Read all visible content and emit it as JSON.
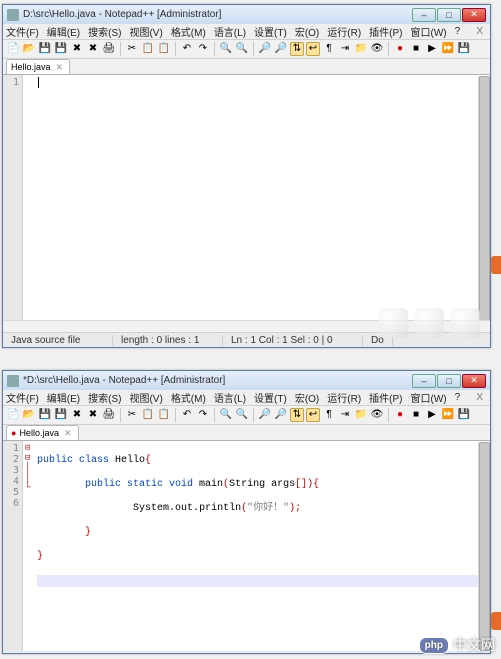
{
  "window1": {
    "title": "D:\\src\\Hello.java - Notepad++ [Administrator]",
    "tab_label": "Hello.java",
    "line_numbers": [
      "1"
    ],
    "code_lines": [
      ""
    ],
    "statusbar": {
      "type": "Java source file",
      "length": "length : 0    lines : 1",
      "pos": "Ln : 1    Col : 1    Sel : 0 | 0",
      "enc": "Do"
    }
  },
  "window2": {
    "title": "*D:\\src\\Hello.java - Notepad++ [Administrator]",
    "tab_label": "Hello.java",
    "line_numbers": [
      "1",
      "2",
      "3",
      "4",
      "5",
      "6"
    ]
  },
  "chart_data": {
    "type": "table",
    "title": "Hello.java source code",
    "rows": [
      {
        "line": 1,
        "text": "public class Hello{"
      },
      {
        "line": 2,
        "text": "        public static void main(String args[]){"
      },
      {
        "line": 3,
        "text": "                System.out.println(\"你好！\");"
      },
      {
        "line": 4,
        "text": "        }"
      },
      {
        "line": 5,
        "text": "}"
      },
      {
        "line": 6,
        "text": ""
      }
    ]
  },
  "menu": {
    "file": "文件(F)",
    "edit": "编辑(E)",
    "search": "搜索(S)",
    "view": "视图(V)",
    "format": "格式(M)",
    "lang": "语言(L)",
    "settings": "设置(T)",
    "macro": "宏(O)",
    "run": "运行(R)",
    "plugins": "插件(P)",
    "window": "窗口(W)",
    "help": "?"
  },
  "watermark": "中文网",
  "code": {
    "l1a": "public",
    "l1b": " class",
    "l1c": " Hello",
    "l1d": "{",
    "l2a": "        public static void",
    "l2b": " main",
    "l2c": "(",
    "l2d": "String args",
    "l2e": "[])",
    "l2f": "{",
    "l3a": "                System",
    "l3b": ".",
    "l3c": "out",
    "l3d": ".",
    "l3e": "println",
    "l3f": "(",
    "l3g": "\"你好！\"",
    "l3h": ");",
    "l4a": "        ",
    "l4b": "}",
    "l5a": "}"
  }
}
